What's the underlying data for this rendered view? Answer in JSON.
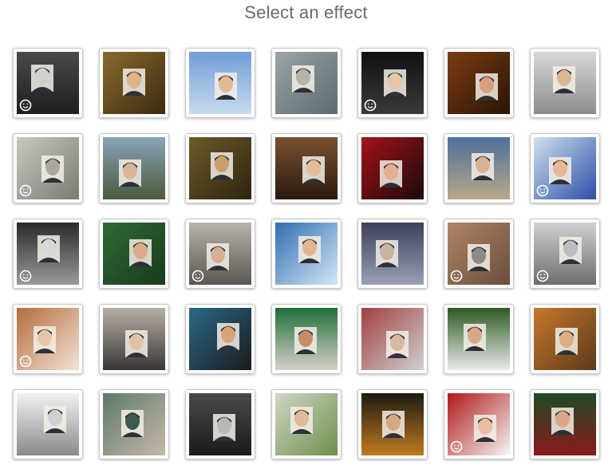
{
  "header": {
    "title": "Select an effect"
  },
  "badge_icon": "smiley-face-icon",
  "effects": [
    {
      "id": "hooded-man",
      "bg": "#4a4a4a",
      "bg2": "#1e1e1e",
      "skin": "#cfcfcf",
      "face": true
    },
    {
      "id": "desert-market",
      "bg": "#8a6a2e",
      "bg2": "#3b2a10",
      "skin": "#e0b28a",
      "face": false
    },
    {
      "id": "city-billboard",
      "bg": "#6f9ed6",
      "bg2": "#c8d9ee",
      "skin": "#e3b994",
      "face": false
    },
    {
      "id": "stone-wall-portrait",
      "bg": "#9aa4aa",
      "bg2": "#5e6a70",
      "skin": "#b8b2a8",
      "face": false
    },
    {
      "id": "bride-veil",
      "bg": "#111111",
      "bg2": "#3a3a3a",
      "skin": "#e8c4a4",
      "face": true
    },
    {
      "id": "workshop-woman",
      "bg": "#7a3c12",
      "bg2": "#2a1406",
      "skin": "#d6a07a",
      "face": false
    },
    {
      "id": "car-window",
      "bg": "#d8d8d8",
      "bg2": "#8c8c8c",
      "skin": "#dcb594",
      "face": false
    },
    {
      "id": "old-woman-sketch",
      "bg": "#c8c8c0",
      "bg2": "#7b7b74",
      "skin": "#a8a89e",
      "face": true
    },
    {
      "id": "building-poster",
      "bg": "#8aa3b8",
      "bg2": "#4a5a3a",
      "skin": "#d9b495",
      "face": false
    },
    {
      "id": "gold-frame-mosaic",
      "bg": "#6b5a28",
      "bg2": "#2e2410",
      "skin": "#c9a06a",
      "face": false
    },
    {
      "id": "hands-photos",
      "bg": "#7a5030",
      "bg2": "#2a1a10",
      "skin": "#e2bd9a",
      "face": false
    },
    {
      "id": "red-theater",
      "bg": "#a3121a",
      "bg2": "#1a0a0a",
      "skin": "#e2b08e",
      "face": false
    },
    {
      "id": "cats-photo",
      "bg": "#4d6f9a",
      "bg2": "#b8a888",
      "skin": "#d7b293",
      "face": false
    },
    {
      "id": "superhero",
      "bg": "#cfe0ee",
      "bg2": "#2c4fa8",
      "skin": "#e6b896",
      "face": true
    },
    {
      "id": "ornate-mirror",
      "bg": "#2a2a2a",
      "bg2": "#9a9a9a",
      "skin": "#d8d8d8",
      "face": true
    },
    {
      "id": "museum-painting",
      "bg": "#2e6a34",
      "bg2": "#1a3a1e",
      "skin": "#d8ac86",
      "face": false
    },
    {
      "id": "mugshot-sign",
      "bg": "#b8b4ac",
      "bg2": "#5a5650",
      "skin": "#d6b094",
      "face": true
    },
    {
      "id": "blue-portrait",
      "bg": "#2f6fb3",
      "bg2": "#d6e6f4",
      "skin": "#e4b690",
      "face": false
    },
    {
      "id": "night-billboard",
      "bg": "#3c3f5a",
      "bg2": "#9aa0b8",
      "skin": "#c9b2a0",
      "face": false
    },
    {
      "id": "chest-tattoo",
      "bg": "#b08466",
      "bg2": "#6a4e3c",
      "skin": "#8a8a80",
      "face": true
    },
    {
      "id": "aviator-vintage",
      "bg": "#d0d0d0",
      "bg2": "#6e6e6e",
      "skin": "#bdbdbd",
      "face": true
    },
    {
      "id": "pencil-drawing",
      "bg": "#b66b3c",
      "bg2": "#f0e4d6",
      "skin": "#e6c6a6",
      "face": true
    },
    {
      "id": "woman-holding-photo",
      "bg": "#b7b0a6",
      "bg2": "#3a3634",
      "skin": "#e0c2a4",
      "face": false
    },
    {
      "id": "dancer-closeup",
      "bg": "#2a6a8a",
      "bg2": "#1a1a1a",
      "skin": "#d8a27a",
      "face": false
    },
    {
      "id": "model-dress",
      "bg": "#1e6e3a",
      "bg2": "#d8d0c8",
      "skin": "#c98c6a",
      "face": false
    },
    {
      "id": "street-screen",
      "bg": "#a04040",
      "bg2": "#d0d0d0",
      "skin": "#d8b8a0",
      "face": false
    },
    {
      "id": "grass-shirt",
      "bg": "#2d5a22",
      "bg2": "#eaeaea",
      "skin": "#d7a888",
      "face": false
    },
    {
      "id": "cat-frame",
      "bg": "#c8772a",
      "bg2": "#5a3a1a",
      "skin": "#dcae86",
      "face": false
    },
    {
      "id": "hand-sketch",
      "bg": "#f2f2f2",
      "bg2": "#8a8a8a",
      "skin": "#cfcfcf",
      "face": false
    },
    {
      "id": "eye-reflection",
      "bg": "#5c7a6a",
      "bg2": "#c8b8a8",
      "skin": "#3e5a4e",
      "face": false
    },
    {
      "id": "crowd-sign",
      "bg": "#4a4a4a",
      "bg2": "#1a1a1a",
      "skin": "#b8b8b8",
      "face": false
    },
    {
      "id": "photo-collage",
      "bg": "#cfd6c6",
      "bg2": "#6e8f4a",
      "skin": "#e0b89a",
      "face": false
    },
    {
      "id": "night-street-frame",
      "bg": "#1e1a12",
      "bg2": "#c07a20",
      "skin": "#d6a880",
      "face": false
    },
    {
      "id": "santa",
      "bg": "#b01818",
      "bg2": "#f4f4f4",
      "skin": "#e8c0a0",
      "face": true
    },
    {
      "id": "christmas-ornaments",
      "bg": "#1e4a26",
      "bg2": "#8a1a1a",
      "skin": "#d8a888",
      "face": false
    }
  ]
}
